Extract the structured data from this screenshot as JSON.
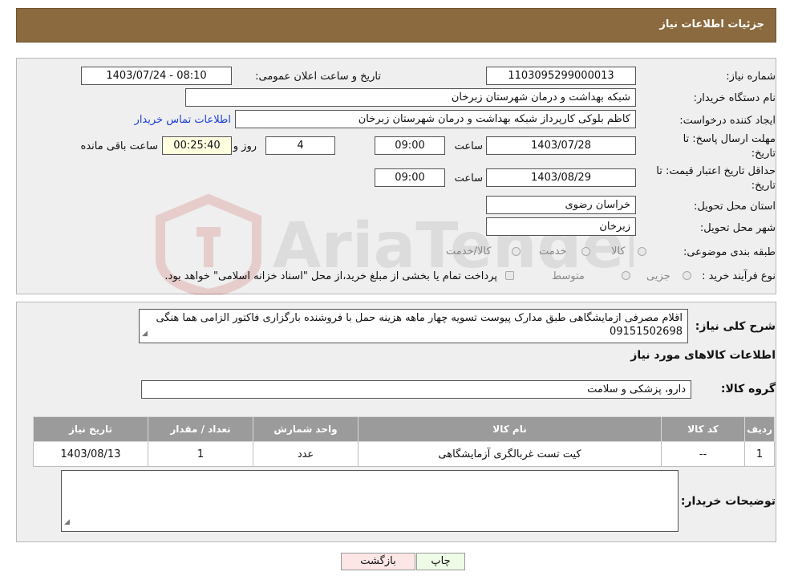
{
  "header": {
    "title": "جزئیات اطلاعات نیاز"
  },
  "form": {
    "need_number_label": "شماره نیاز:",
    "need_number": "1103095299000013",
    "announce_label": "تاریخ و ساعت اعلان عمومی:",
    "announce_value": "1403/07/24 - 08:10",
    "buyer_org_label": "نام دستگاه خریدار:",
    "buyer_org": "شبکه بهداشت و درمان شهرستان زبرخان",
    "creator_label": "ایجاد کننده درخواست:",
    "creator": "کاظم بلوکی کارپرداز شبکه بهداشت و درمان شهرستان زبرخان",
    "contact_link": "اطلاعات تماس خریدار",
    "deadline_label_1": "مهلت ارسال پاسخ: تا",
    "deadline_label_2": "تاریخ:",
    "deadline_date": "1403/07/28",
    "time_label": "ساعت",
    "deadline_time": "09:00",
    "days_value": "4",
    "days_label": "روز و",
    "remaining_value": "00:25:40",
    "remaining_label": "ساعت باقی مانده",
    "validity_label_1": "حداقل تاریخ اعتبار قیمت: تا",
    "validity_label_2": "تاریخ:",
    "validity_date": "1403/08/29",
    "validity_time_label": "ساعت",
    "validity_time": "09:00",
    "province_label": "استان محل تحویل:",
    "province": "خراسان رضوی",
    "city_label": "شهر محل تحویل:",
    "city": "زبرخان",
    "category_label": "طبقه بندی موضوعی:",
    "category_options": [
      "کالا",
      "خدمت",
      "کالا/خدمت"
    ],
    "process_label": "نوع فرآیند خرید :",
    "process_options": [
      "جزیی",
      "متوسط"
    ],
    "process_note": "پرداخت تمام یا بخشی از مبلغ خرید،از محل \"اسناد خزانه اسلامی\" خواهد بود."
  },
  "watermark": {
    "text": "AriaTender.neT"
  },
  "details": {
    "description_label": "شرح کلی نیاز:",
    "description": "اقلام مصرفی ازمایشگاهی طبق مدارک پیوست تسویه چهار ماهه هزینه حمل با فروشنده بارگزاری فاکتور الزامی هما هنگی 09151502698",
    "goods_info_title": "اطلاعات کالاهای مورد نیاز",
    "goods_group_label": "گروه کالا:",
    "goods_group": "دارو، پزشکی و سلامت",
    "table": {
      "headers": [
        "ردیف",
        "کد کالا",
        "نام کالا",
        "واحد شمارش",
        "تعداد / مقدار",
        "تاریخ نیاز"
      ],
      "rows": [
        [
          "1",
          "--",
          "کیت تست غربالگری آزمایشگاهی",
          "عدد",
          "1",
          "1403/08/13"
        ]
      ]
    },
    "buyer_notes_label": "توضیحات خریدار:",
    "buyer_notes": ""
  },
  "buttons": {
    "print": "چاپ",
    "back": "بازگشت"
  },
  "colors": {
    "header_bg": "#8a6a3e",
    "table_header_bg": "#9b9b9b",
    "link": "#1a3fd8"
  }
}
